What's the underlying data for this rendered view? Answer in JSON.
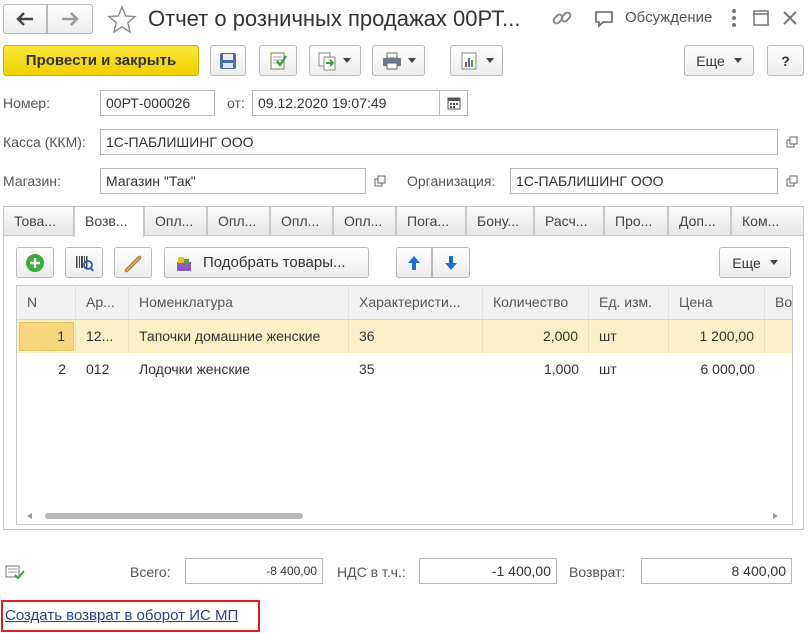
{
  "title": "Отчет о розничных продажах 00РТ...",
  "header": {
    "discussion_label": "Обсуждение"
  },
  "toolbar": {
    "post_close_label": "Провести и закрыть",
    "more_label": "Еще",
    "help_label": "?"
  },
  "form": {
    "number_label": "Номер:",
    "number_value": "00РТ-000026",
    "date_label": "от:",
    "date_value": "09.12.2020 19:07:49",
    "register_label": "Касса (ККМ):",
    "register_value": "1С-ПАБЛИШИНГ ООО",
    "store_label": "Магазин:",
    "store_value": "Магазин \"Так\"",
    "org_label": "Организация:",
    "org_value": "1С-ПАБЛИШИНГ ООО"
  },
  "tabs": [
    {
      "label": "Това..."
    },
    {
      "label": "Возв..."
    },
    {
      "label": "Опл..."
    },
    {
      "label": "Опл..."
    },
    {
      "label": "Опл..."
    },
    {
      "label": "Опл..."
    },
    {
      "label": "Пога..."
    },
    {
      "label": "Бону..."
    },
    {
      "label": "Расч..."
    },
    {
      "label": "Про..."
    },
    {
      "label": "Доп..."
    },
    {
      "label": "Ком..."
    }
  ],
  "table_toolbar": {
    "pick_goods_label": "Подобрать товары...",
    "more_label": "Еще"
  },
  "table": {
    "columns": [
      "N",
      "Ар...",
      "Номенклатура",
      "Характеристи...",
      "Количество",
      "Ед. изм.",
      "Цена",
      "Во"
    ],
    "rows": [
      {
        "n": "1",
        "art": "12...",
        "name": "Тапочки домашние женские",
        "char": "36",
        "qty": "2,000",
        "unit": "шт",
        "price": "1 200,00"
      },
      {
        "n": "2",
        "art": "012",
        "name": "Лодочки женские",
        "char": "35",
        "qty": "1,000",
        "unit": "шт",
        "price": "6 000,00"
      }
    ]
  },
  "totals": {
    "total_label": "Всего:",
    "total_value": "-8 400,00",
    "vat_label": "НДС в т.ч.:",
    "vat_value": "-1 400,00",
    "return_label": "Возврат:",
    "return_value": "8 400,00"
  },
  "footer": {
    "create_return_link": "Создать возврат в оборот ИС МП"
  },
  "colors": {
    "primary_button": "#f5d90e",
    "selected_row": "#fbf0c6",
    "link": "#2a3f8f",
    "highlight_box": "#e02020"
  }
}
